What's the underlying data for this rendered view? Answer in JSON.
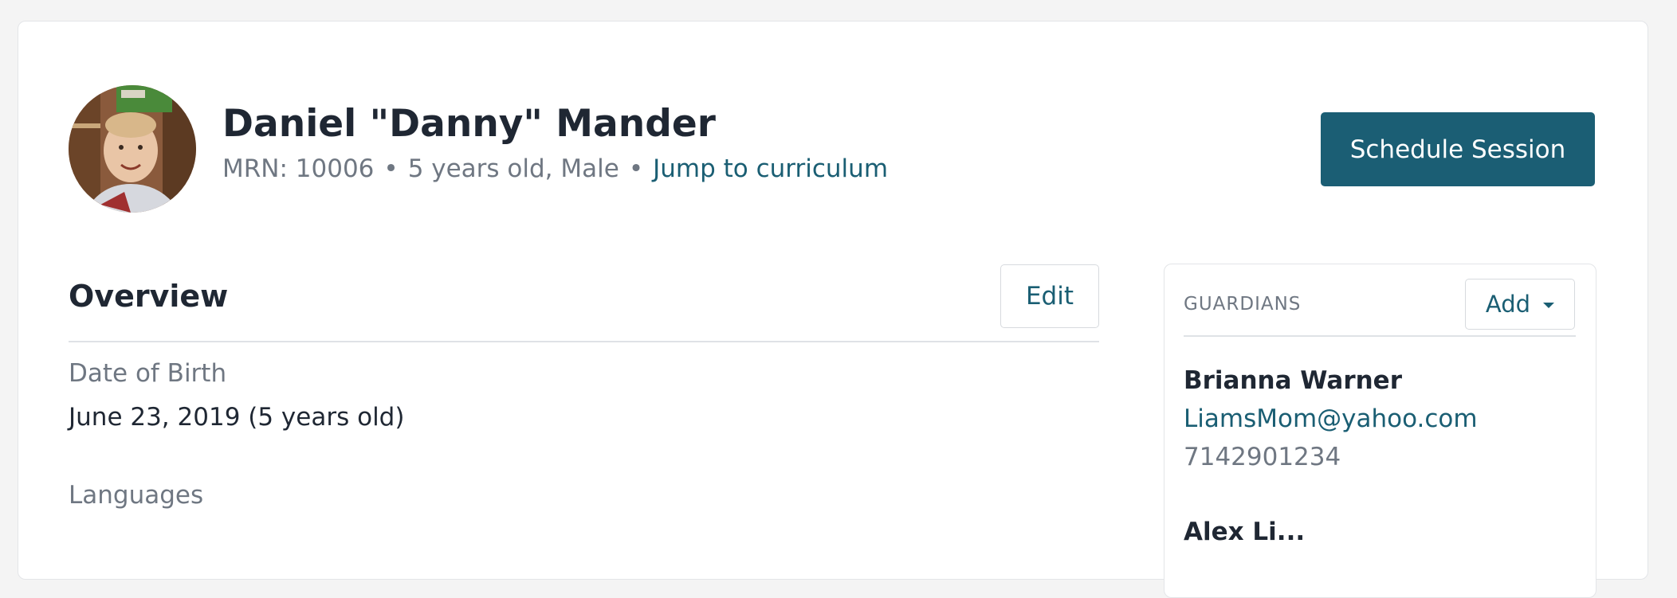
{
  "patient": {
    "name": "Daniel \"Danny\" Mander",
    "mrn": "MRN: 10006",
    "age_gender": "5 years old, Male",
    "separator": "•",
    "curriculum_link": "Jump to curriculum"
  },
  "header": {
    "schedule_button": "Schedule Session"
  },
  "overview": {
    "title": "Overview",
    "edit_button": "Edit",
    "fields": [
      {
        "label": "Date of Birth",
        "value": "June 23, 2019 (5 years old)"
      },
      {
        "label": "Languages",
        "value": ""
      }
    ]
  },
  "guardians": {
    "heading": "GUARDIANS",
    "add_button": "Add",
    "items": [
      {
        "name": "Brianna Warner",
        "email": "LiamsMom@yahoo.com",
        "phone": "7142901234"
      },
      {
        "name": "Alex Li..."
      }
    ]
  },
  "icons": {
    "dropdown": "caret-down-icon",
    "avatar": "avatar-photo"
  },
  "colors": {
    "primary": "#1b5e74",
    "link": "#1a5e73",
    "muted_text": "#6f7782",
    "body_text": "#1f2733",
    "page_background": "#f4f4f4"
  }
}
